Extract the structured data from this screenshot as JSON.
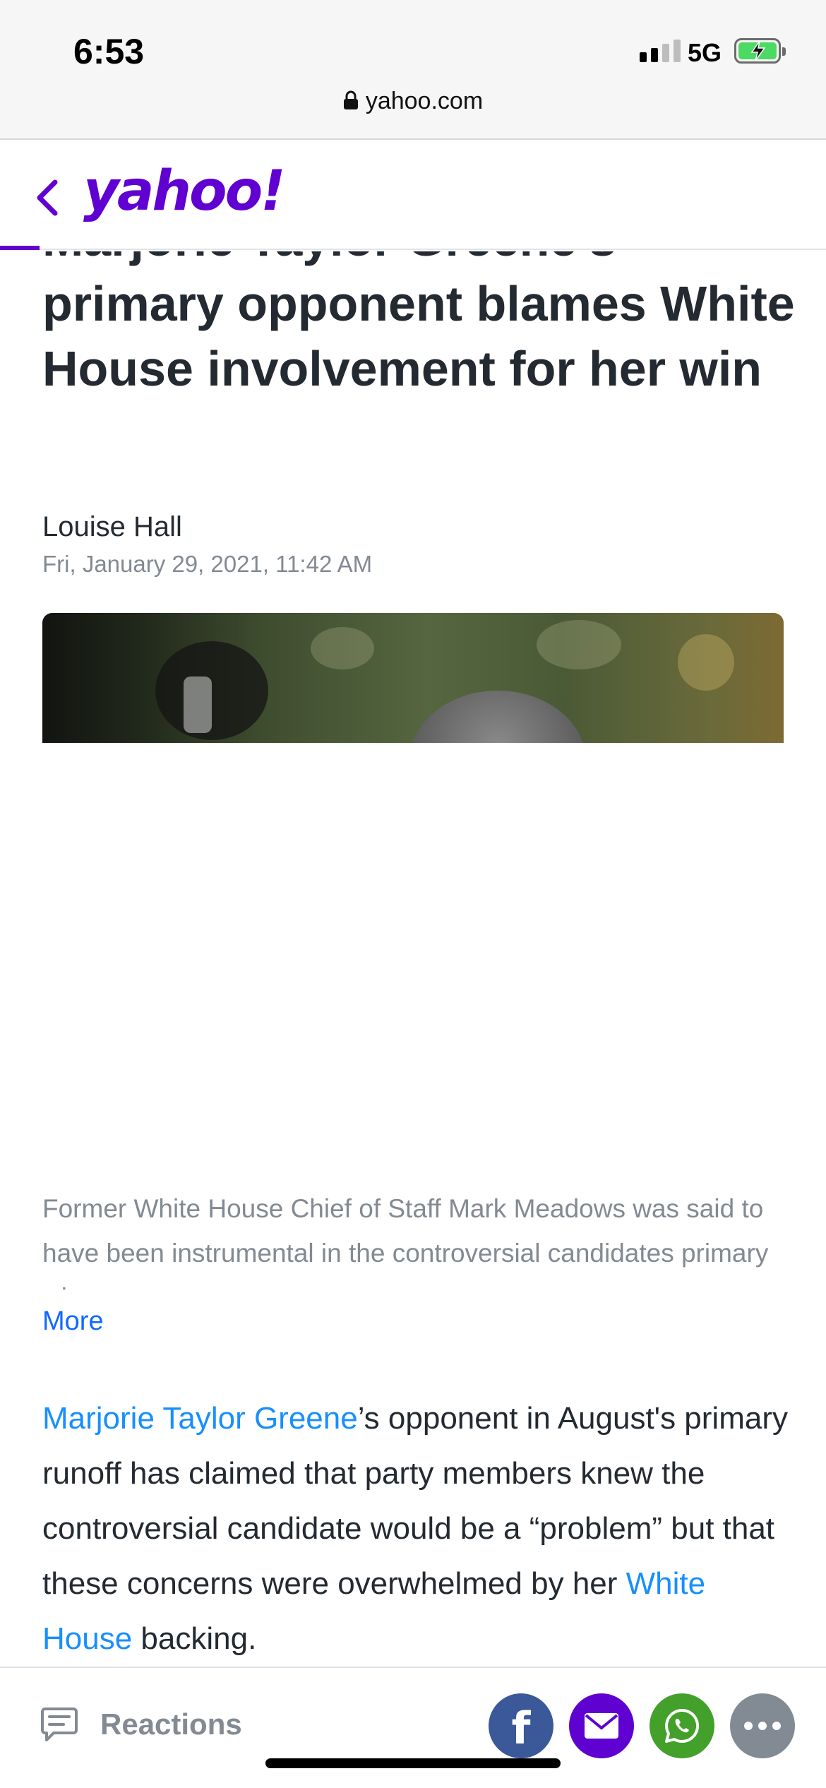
{
  "status_bar": {
    "time": "6:53",
    "network": "5G",
    "url": "yahoo.com"
  },
  "header": {
    "logo": "yahoo!",
    "brand_color": "#6001d2"
  },
  "article": {
    "headline": "Marjorie Taylor Greene's primary opponent blames White House involvement for her win",
    "author": "Louise Hall",
    "timestamp": "Fri, January 29, 2021, 11:42 AM",
    "caption": "Former White House Chief of Staff Mark Meadows was said to have been instrumental in the controversial candidates primary win",
    "more_label": "More",
    "body": {
      "link_1": "Marjorie Taylor Greene",
      "text_1": "’s opponent in August's primary runoff has claimed that party members knew the controversial candidate would be a “problem” but that these concerns were overwhelmed by her ",
      "link_2": "White House",
      "text_2": " backing."
    },
    "link_color": "#188fff"
  },
  "bottom_bar": {
    "reactions_label": "Reactions",
    "share_icons": [
      "facebook-icon",
      "mail-icon",
      "whatsapp-icon",
      "more-icon"
    ]
  }
}
